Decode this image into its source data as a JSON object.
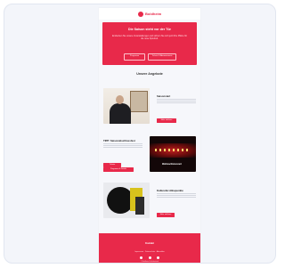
{
  "brand": {
    "accent_color": "#e8294a",
    "logo_text": "Boldheim"
  },
  "hero": {
    "title": "Die Saison steht vor der Tür",
    "text": "Entdecken Sie unsere Veranstaltungen und sichern Sie sich jetzt Ihre Plätze für die neue Spielzeit.",
    "button_1": "Programm",
    "button_2": "Tickets & Abonnements"
  },
  "section_title": "Unsere Angebote",
  "features": [
    {
      "title": "Saisonstart",
      "button": "Mehr erfahren"
    },
    {
      "title": "TIPP: Saisonabschlussfest",
      "button_a": "Tickets",
      "button_c": "Programm & Details"
    },
    {
      "title": "Kulturelle Höhepunkte",
      "button": "Mehr erfahren"
    }
  ],
  "image_caption": "Weihnachtskonzert",
  "footer": {
    "title": "Kontakt",
    "links": "Impressum · Datenschutz · Abmelden",
    "small": "© Boldheim Kulturbetrieb"
  }
}
